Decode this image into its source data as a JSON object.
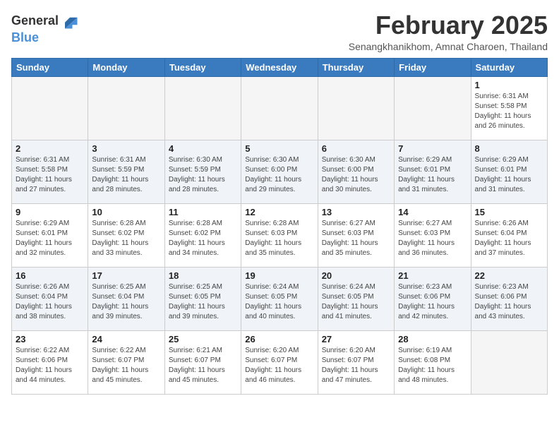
{
  "header": {
    "logo_line1": "General",
    "logo_line2": "Blue",
    "month_title": "February 2025",
    "location": "Senangkhanikhom, Amnat Charoen, Thailand"
  },
  "weekdays": [
    "Sunday",
    "Monday",
    "Tuesday",
    "Wednesday",
    "Thursday",
    "Friday",
    "Saturday"
  ],
  "weeks": [
    [
      {
        "day": "",
        "info": ""
      },
      {
        "day": "",
        "info": ""
      },
      {
        "day": "",
        "info": ""
      },
      {
        "day": "",
        "info": ""
      },
      {
        "day": "",
        "info": ""
      },
      {
        "day": "",
        "info": ""
      },
      {
        "day": "1",
        "info": "Sunrise: 6:31 AM\nSunset: 5:58 PM\nDaylight: 11 hours\nand 26 minutes."
      }
    ],
    [
      {
        "day": "2",
        "info": "Sunrise: 6:31 AM\nSunset: 5:58 PM\nDaylight: 11 hours\nand 27 minutes."
      },
      {
        "day": "3",
        "info": "Sunrise: 6:31 AM\nSunset: 5:59 PM\nDaylight: 11 hours\nand 28 minutes."
      },
      {
        "day": "4",
        "info": "Sunrise: 6:30 AM\nSunset: 5:59 PM\nDaylight: 11 hours\nand 28 minutes."
      },
      {
        "day": "5",
        "info": "Sunrise: 6:30 AM\nSunset: 6:00 PM\nDaylight: 11 hours\nand 29 minutes."
      },
      {
        "day": "6",
        "info": "Sunrise: 6:30 AM\nSunset: 6:00 PM\nDaylight: 11 hours\nand 30 minutes."
      },
      {
        "day": "7",
        "info": "Sunrise: 6:29 AM\nSunset: 6:01 PM\nDaylight: 11 hours\nand 31 minutes."
      },
      {
        "day": "8",
        "info": "Sunrise: 6:29 AM\nSunset: 6:01 PM\nDaylight: 11 hours\nand 31 minutes."
      }
    ],
    [
      {
        "day": "9",
        "info": "Sunrise: 6:29 AM\nSunset: 6:01 PM\nDaylight: 11 hours\nand 32 minutes."
      },
      {
        "day": "10",
        "info": "Sunrise: 6:28 AM\nSunset: 6:02 PM\nDaylight: 11 hours\nand 33 minutes."
      },
      {
        "day": "11",
        "info": "Sunrise: 6:28 AM\nSunset: 6:02 PM\nDaylight: 11 hours\nand 34 minutes."
      },
      {
        "day": "12",
        "info": "Sunrise: 6:28 AM\nSunset: 6:03 PM\nDaylight: 11 hours\nand 35 minutes."
      },
      {
        "day": "13",
        "info": "Sunrise: 6:27 AM\nSunset: 6:03 PM\nDaylight: 11 hours\nand 35 minutes."
      },
      {
        "day": "14",
        "info": "Sunrise: 6:27 AM\nSunset: 6:03 PM\nDaylight: 11 hours\nand 36 minutes."
      },
      {
        "day": "15",
        "info": "Sunrise: 6:26 AM\nSunset: 6:04 PM\nDaylight: 11 hours\nand 37 minutes."
      }
    ],
    [
      {
        "day": "16",
        "info": "Sunrise: 6:26 AM\nSunset: 6:04 PM\nDaylight: 11 hours\nand 38 minutes."
      },
      {
        "day": "17",
        "info": "Sunrise: 6:25 AM\nSunset: 6:04 PM\nDaylight: 11 hours\nand 39 minutes."
      },
      {
        "day": "18",
        "info": "Sunrise: 6:25 AM\nSunset: 6:05 PM\nDaylight: 11 hours\nand 39 minutes."
      },
      {
        "day": "19",
        "info": "Sunrise: 6:24 AM\nSunset: 6:05 PM\nDaylight: 11 hours\nand 40 minutes."
      },
      {
        "day": "20",
        "info": "Sunrise: 6:24 AM\nSunset: 6:05 PM\nDaylight: 11 hours\nand 41 minutes."
      },
      {
        "day": "21",
        "info": "Sunrise: 6:23 AM\nSunset: 6:06 PM\nDaylight: 11 hours\nand 42 minutes."
      },
      {
        "day": "22",
        "info": "Sunrise: 6:23 AM\nSunset: 6:06 PM\nDaylight: 11 hours\nand 43 minutes."
      }
    ],
    [
      {
        "day": "23",
        "info": "Sunrise: 6:22 AM\nSunset: 6:06 PM\nDaylight: 11 hours\nand 44 minutes."
      },
      {
        "day": "24",
        "info": "Sunrise: 6:22 AM\nSunset: 6:07 PM\nDaylight: 11 hours\nand 45 minutes."
      },
      {
        "day": "25",
        "info": "Sunrise: 6:21 AM\nSunset: 6:07 PM\nDaylight: 11 hours\nand 45 minutes."
      },
      {
        "day": "26",
        "info": "Sunrise: 6:20 AM\nSunset: 6:07 PM\nDaylight: 11 hours\nand 46 minutes."
      },
      {
        "day": "27",
        "info": "Sunrise: 6:20 AM\nSunset: 6:07 PM\nDaylight: 11 hours\nand 47 minutes."
      },
      {
        "day": "28",
        "info": "Sunrise: 6:19 AM\nSunset: 6:08 PM\nDaylight: 11 hours\nand 48 minutes."
      },
      {
        "day": "",
        "info": ""
      }
    ]
  ]
}
